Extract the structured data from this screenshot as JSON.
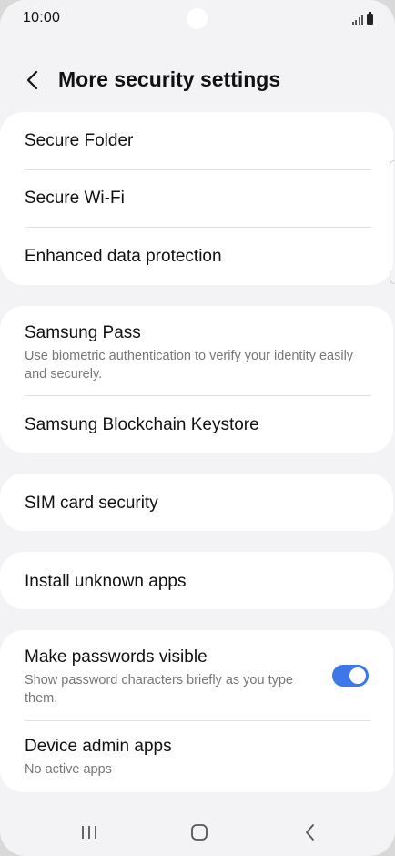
{
  "status_bar": {
    "time": "10:00"
  },
  "header": {
    "title": "More security settings"
  },
  "group1": {
    "items": [
      {
        "title": "Secure Folder"
      },
      {
        "title": "Secure Wi-Fi"
      },
      {
        "title": "Enhanced data protection"
      }
    ]
  },
  "group2": {
    "items": [
      {
        "title": "Samsung Pass",
        "subtitle": "Use biometric authentication to verify your identity easily and securely."
      },
      {
        "title": "Samsung Blockchain Keystore"
      }
    ]
  },
  "group3": {
    "items": [
      {
        "title": "SIM card security"
      }
    ]
  },
  "group4": {
    "items": [
      {
        "title": "Install unknown apps"
      }
    ]
  },
  "group5": {
    "items": [
      {
        "title": "Make passwords visible",
        "subtitle": "Show password characters briefly as you type them.",
        "toggle_on": true
      },
      {
        "title": "Device admin apps",
        "subtitle": "No active apps"
      }
    ]
  },
  "colors": {
    "accent": "#3e78e8",
    "background": "#f3f3f6",
    "card": "#ffffff"
  },
  "icons": {
    "back": "chevron-left-icon",
    "nav_recents": "recents-icon",
    "nav_home": "home-icon",
    "nav_back": "back-icon"
  }
}
